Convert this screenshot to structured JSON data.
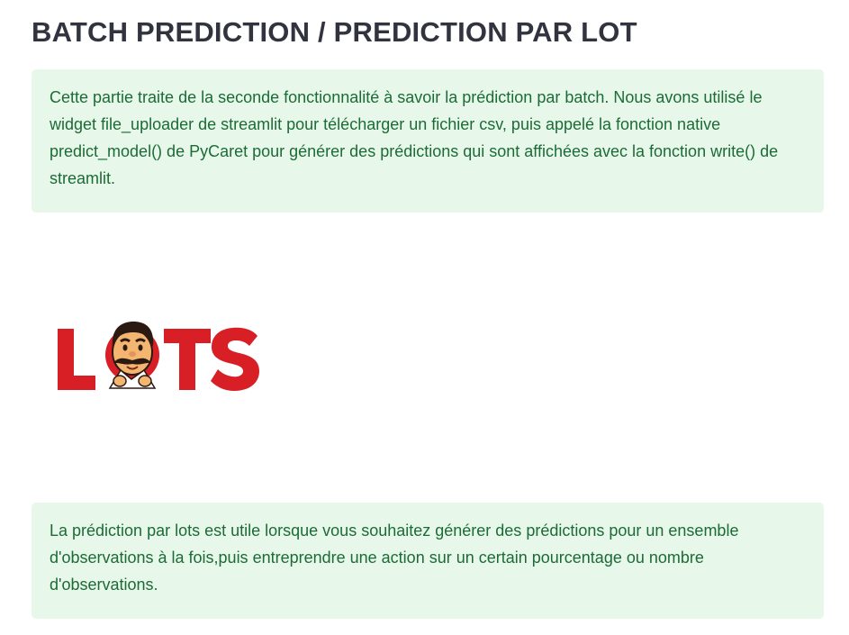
{
  "header": {
    "title": "BATCH PREDICTION / PREDICTION PAR LOT"
  },
  "info_boxes": [
    {
      "text": "Cette partie traite de la seconde fonctionnalité à savoir la prédiction par batch. Nous avons utilisé le widget file_uploader de streamlit pour télécharger un fichier csv, puis appelé la fonction native predict_model() de PyCaret pour générer des prédictions qui sont affichées avec la fonction write() de streamlit."
    },
    {
      "text": "La prédiction par lots est utile lorsque vous souhaitez générer des prédictions pour un ensemble d'observations à la fois,puis entreprendre une action sur un certain pourcentage ou nombre d'observations."
    }
  ],
  "logo": {
    "text": "LOTS",
    "color": "#d91f26",
    "mascot": "mustached-man-emoji"
  },
  "colors": {
    "title": "#31333f",
    "alert_bg": "#e7f8ea",
    "alert_text": "#1c6b36"
  }
}
